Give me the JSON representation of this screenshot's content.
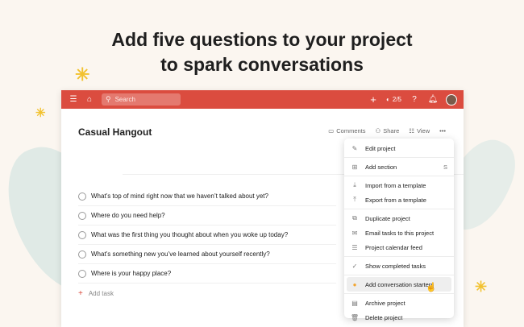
{
  "headline": {
    "line1": "Add five questions to your project",
    "line2": "to spark conversations"
  },
  "topbar": {
    "search_placeholder": "Search",
    "karma": "2/5",
    "icons": [
      "menu-icon",
      "home-icon",
      "search-icon",
      "add-icon",
      "karma-icon",
      "help-icon",
      "bell-icon",
      "avatar"
    ]
  },
  "project": {
    "title": "Casual Hangout",
    "actions": {
      "comments": "Comments",
      "share": "Share",
      "view": "View"
    }
  },
  "tasks": [
    "What’s top of mind right now that we haven’t talked about yet?",
    "Where do you need help?",
    "What was the first thing you thought about when you woke up today?",
    "What’s something new you’ve learned about yourself recently?",
    "Where is your happy place?"
  ],
  "add_task": "Add task",
  "menu": {
    "edit": "Edit project",
    "add_section": "Add section",
    "add_section_shortcut": "S",
    "import": "Import from a template",
    "export": "Export from a template",
    "duplicate": "Duplicate project",
    "email": "Email tasks to this project",
    "calendar": "Project calendar feed",
    "completed": "Show completed tasks",
    "starters": "Add conversation starters",
    "archive": "Archive project",
    "delete": "Delete project"
  },
  "colors": {
    "brand": "#db4c3f",
    "background": "#fbf6f0",
    "accent": "#f2c230"
  }
}
